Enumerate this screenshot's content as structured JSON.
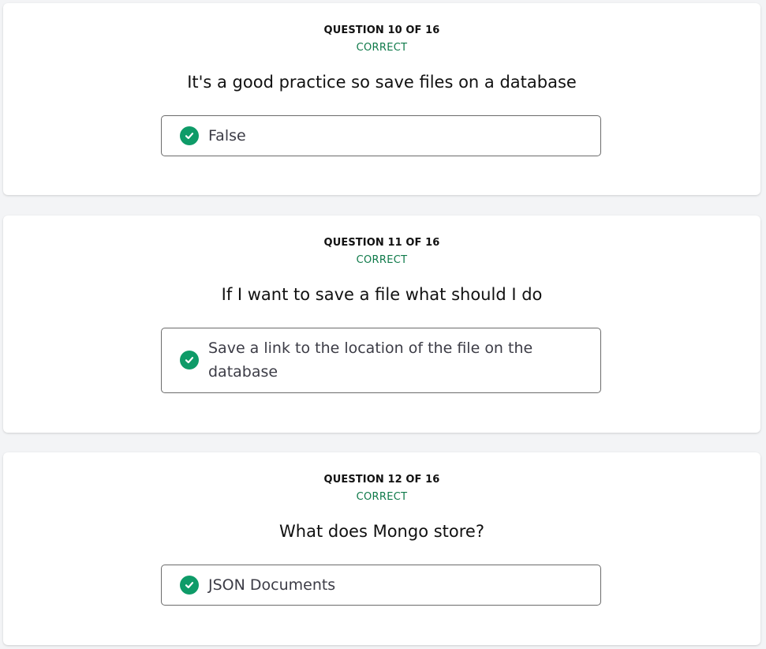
{
  "questions": [
    {
      "counter": "QUESTION 10 OF 16",
      "status": "CORRECT",
      "text": "It's a good practice so save files on a database",
      "answer": "False",
      "answer_icon": "check-circle-icon"
    },
    {
      "counter": "QUESTION 11 OF 16",
      "status": "CORRECT",
      "text": "If I want to save a file what should I do",
      "answer": "Save a link to the location of the file on the database",
      "answer_icon": "check-circle-icon"
    },
    {
      "counter": "QUESTION 12 OF 16",
      "status": "CORRECT",
      "text": "What does Mongo store?",
      "answer": "JSON Documents",
      "answer_icon": "check-circle-icon"
    }
  ],
  "colors": {
    "correct_text": "#0f7a4a",
    "check_fill": "#0e9b68",
    "page_background": "#f3f4f6"
  }
}
